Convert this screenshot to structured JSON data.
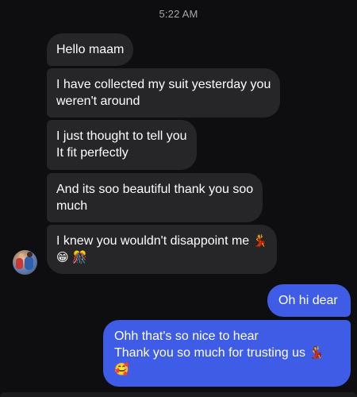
{
  "header": {
    "time": "5:22 AM"
  },
  "messages": {
    "m1": {
      "line1": "Hello maam"
    },
    "m2": {
      "line1": "I have collected my suit yesterday you",
      "line2": "weren't around"
    },
    "m3": {
      "line1": "I just thought to tell you",
      "line2": "It fit perfectly"
    },
    "m4": {
      "line1": "And its soo beautiful thank you soo",
      "line2": "much"
    },
    "m5": {
      "line1": "I knew you wouldn't disappoint me",
      "emoji1": "💃",
      "emoji2": "😁",
      "emoji3": "🎊"
    },
    "m6": {
      "line1": "Oh hi dear"
    },
    "m7": {
      "line1": "Ohh that's so nice to hear",
      "line2": "Thank you so much for trusting us",
      "emoji1": "💃",
      "emoji2": "🥰"
    }
  },
  "colors": {
    "background": "#0e0e10",
    "incoming_bubble": "#262629",
    "outgoing_bubble": "#3e5ce6",
    "timestamp": "#a6a6ab"
  },
  "icons": {
    "sender_avatar": "avatar-photo"
  }
}
